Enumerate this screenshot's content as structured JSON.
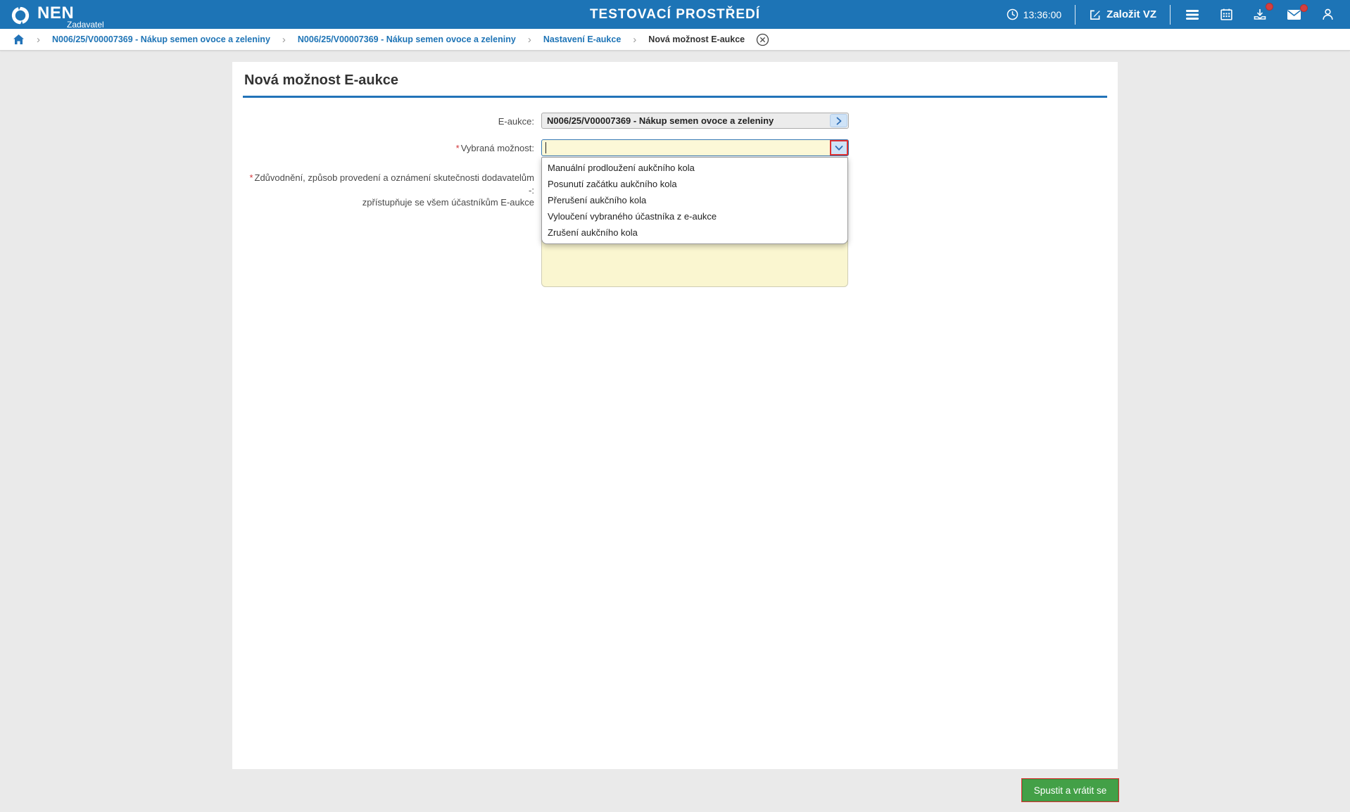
{
  "header": {
    "brand": "NEN",
    "brand_sub": "Zadavatel",
    "env_title": "TESTOVACÍ PROSTŘEDÍ",
    "time": "13:36:00",
    "create_vz_label": "Založit VZ"
  },
  "breadcrumb": {
    "items": [
      "N006/25/V00007369 - Nákup semen ovoce a zeleniny",
      "N006/25/V00007369 - Nákup semen ovoce a zeleniny",
      "Nastavení E-aukce"
    ],
    "current": "Nová možnost E-aukce"
  },
  "page": {
    "title": "Nová možnost E-aukce",
    "form": {
      "required_marker": "*",
      "eaukce_label": "E-aukce:",
      "eaukce_value": "N006/25/V00007369 - Nákup semen ovoce a zeleniny",
      "option_label": "Vybraná možnost:",
      "option_value": "",
      "justification_label_line1": "Zdůvodnění, způsob provedení a oznámení skutečnosti dodavatelům -:",
      "justification_label_line2": "zpřístupňuje se všem účastníkům E-aukce",
      "justification_value": ""
    },
    "dropdown_options": [
      "Manuální prodloužení aukčního kola",
      "Posunutí začátku aukčního kola",
      "Přerušení aukčního kola",
      "Vyloučení vybraného účastníka z e-aukce",
      "Zrušení aukčního kola"
    ]
  },
  "footer": {
    "submit_label": "Spustit a vrátit se"
  },
  "colors": {
    "header_blue": "#1d74b6",
    "accent_blue": "#2273b8",
    "page_bg": "#eaeaea",
    "input_yellow": "#fcf8d7",
    "textarea_yellow": "#faf6d0",
    "required_red": "#d13438",
    "focus_red": "#e03232",
    "submit_green": "#43a047",
    "badge_red": "#d43f3f"
  }
}
